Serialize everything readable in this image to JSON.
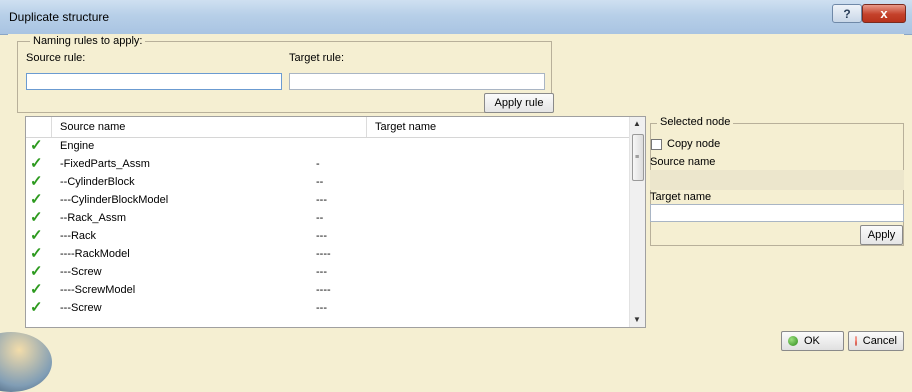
{
  "window": {
    "title": "Duplicate structure",
    "help_glyph": "?",
    "close_glyph": "x"
  },
  "naming": {
    "legend": "Naming rules to apply:",
    "source_rule_label": "Source rule:",
    "source_rule_value": "",
    "target_rule_label": "Target rule:",
    "target_rule_value": "",
    "apply_rule_label": "Apply rule"
  },
  "tree": {
    "col_source": "Source name",
    "col_target": "Target name",
    "rows": [
      {
        "source": "Engine",
        "target": ""
      },
      {
        "source": "-FixedParts_Assm",
        "target": "-"
      },
      {
        "source": "--CylinderBlock",
        "target": "--"
      },
      {
        "source": "---CylinderBlockModel",
        "target": "---"
      },
      {
        "source": "--Rack_Assm",
        "target": "--"
      },
      {
        "source": "---Rack",
        "target": "---"
      },
      {
        "source": "----RackModel",
        "target": "----"
      },
      {
        "source": "---Screw",
        "target": "---"
      },
      {
        "source": "----ScrewModel",
        "target": "----"
      },
      {
        "source": "---Screw",
        "target": "---"
      }
    ]
  },
  "selected_node": {
    "legend": "Selected node",
    "copy_node_label": "Copy node",
    "copy_node_checked": false,
    "source_name_label": "Source name",
    "source_name_value": "",
    "target_name_label": "Target name",
    "target_name_value": "",
    "apply_label": "Apply"
  },
  "footer": {
    "ok_label": "OK",
    "cancel_label": "Cancel"
  },
  "colors": {
    "dialog_bg": "#f5efd2",
    "check_green": "#2d9a1f",
    "ok_green": "#2c8a1a",
    "cancel_red": "#c0281c"
  }
}
